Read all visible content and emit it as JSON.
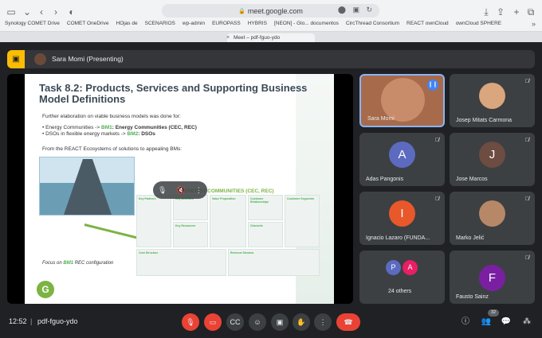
{
  "browser": {
    "url": "meet.google.com",
    "bookmarks": [
      "Synology COMET Drive",
      "COMET OneDrive",
      "HOjas de",
      "SCENARIOS",
      "wp-admin",
      "EUROPASS",
      "HYBRIS",
      "[NEON] - Glo... documentos",
      "CircThread Consortium",
      "REACT ownCloud",
      "ownCloud SPHERE"
    ],
    "tab_title": "Meet – pdf-fguo-ydo"
  },
  "presenter": {
    "label": "Sara Momi (Presenting)"
  },
  "slide": {
    "title": "Task 8.2: Products, Services and Supporting Business Model Definitions",
    "intro": "Further elaboration on viable business models was done for:",
    "bullet1_prefix": "Energy Communities -> ",
    "bullet1_bm": "BM1",
    "bullet1_suffix": ": Energy Communities (CEC, REC)",
    "bullet2_prefix": "DSOs in flexible energy markets -> ",
    "bullet2_bm": "BM2",
    "bullet2_suffix": ": DSOs",
    "from_line": "From the REACT Ecosystems of solutions to appealing BMs:",
    "canvas_title": "ENERGY COMMUNITIES (CEC, REC)",
    "canvas_cells": [
      "Key Partners",
      "Key Activities",
      "Value Proposition",
      "Customer Relationships",
      "Customer Segments",
      "Key Resources",
      "Channels",
      "Cost Structure",
      "Revenue Streams"
    ],
    "focus_prefix": "Focus on ",
    "focus_bm": "BM1",
    "focus_suffix": " REC configuration",
    "logo_letter": "G"
  },
  "participants": [
    {
      "name": "Sara Momi",
      "type": "video",
      "speaking": true
    },
    {
      "name": "Josep Mitats Carmona",
      "type": "photo",
      "muted": true
    },
    {
      "name": "Adas Pangonis",
      "initial": "A",
      "color": "#5c6bc0",
      "muted": true
    },
    {
      "name": "Jose Marcos",
      "initial": "J",
      "color": "#6d4c41",
      "muted": true
    },
    {
      "name": "Ignacio Lazaro (FUNDA...",
      "initial": "I",
      "color": "#e8582b",
      "muted": true
    },
    {
      "name": "Marko Jelić",
      "type": "photo",
      "muted": true
    },
    {
      "name": "24 others",
      "initials": [
        "P",
        "A"
      ],
      "colors": [
        "#5c6bc0",
        "#e91e63"
      ]
    },
    {
      "name": "Fausto Sainz",
      "initial": "F",
      "color": "#7b1fa2",
      "muted": true
    }
  ],
  "bottom_bar": {
    "time": "12:52",
    "separator": "|",
    "meeting_code": "pdf-fguo-ydo",
    "participant_count": "32"
  }
}
